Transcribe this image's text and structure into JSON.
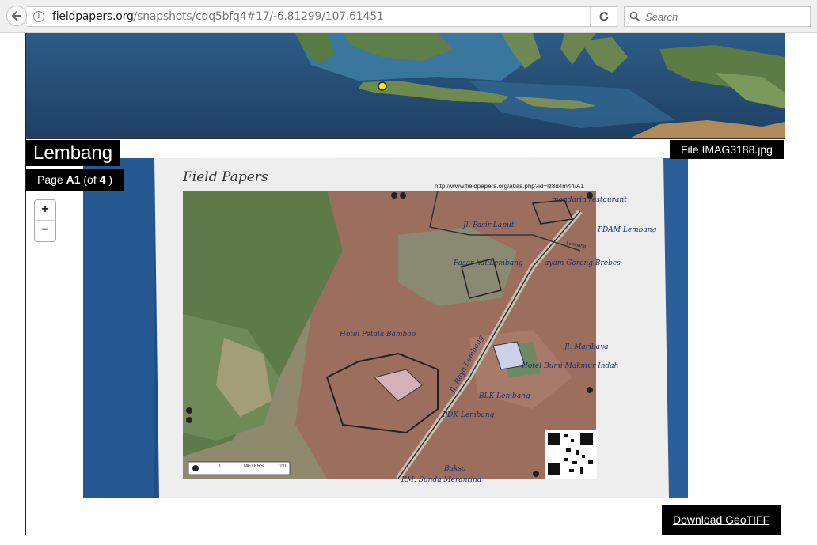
{
  "browser": {
    "url_domain": "fieldpapers.org",
    "url_path": "/snapshots/cdq5bfq4#17/-6.81299/107.61451",
    "search_placeholder": "Search"
  },
  "snapshot": {
    "title": "Lembang",
    "page_label": "Page",
    "page_id": "A1",
    "page_of_prefix": "(of",
    "page_total": "4",
    "page_of_suffix": ")",
    "file_label": "File IMAG3188.jpg",
    "download_label": "Download GeoTIFF"
  },
  "zoom": {
    "in_label": "+",
    "out_label": "−"
  },
  "paper": {
    "heading": "Field Papers",
    "atlas_url": "http://www.fieldpapers.org/atlas.php?id=lz8d4m44/A1",
    "scale_start": "0",
    "scale_unit": "METERS",
    "scale_end": "100",
    "handwritten": {
      "mandarin": "mandarin restaurant",
      "pdam": "PDAM Lembang",
      "pasar": "Pasar hauLembang",
      "ayam": "ayam Goreng Brebes",
      "hotel_petala": "Hotel Petala Bamboo",
      "jl_pasir": "Jl. Pasir Laput",
      "jl_rahu": "Jl. Raya Lembang",
      "jl_maribaya": "Jl. Maribaya",
      "hotel_bumi": "Hotel Bumi Makmur Indah",
      "blk": "BLK Lembang",
      "pdk": "PDK Lembang",
      "rm": "RM. Sunda Merantina",
      "bakso": "Bakso"
    },
    "road_label": "Lembang"
  },
  "colors": {
    "chrome_bg": "#f0f0f0",
    "label_bg": "#000000",
    "label_text": "#ffffff",
    "ocean": "#2e5a83",
    "pin": "#f5e617"
  }
}
